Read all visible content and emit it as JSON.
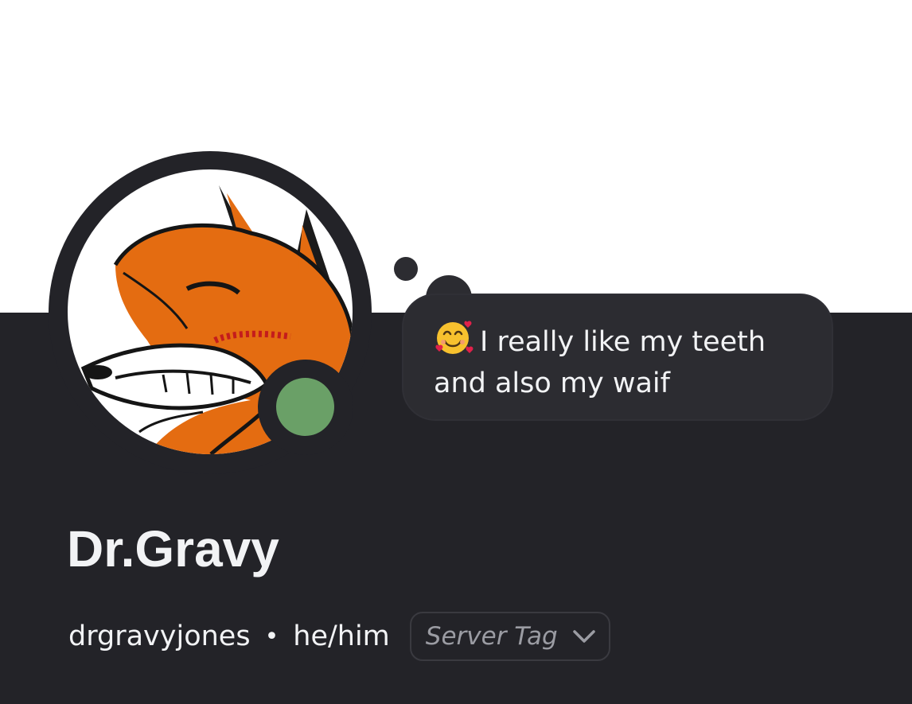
{
  "profile": {
    "display_name": "Dr.Gravy",
    "username": "drgravyjones",
    "separator": "•",
    "pronouns": "he/him",
    "status": "online",
    "status_color": "#6aa067"
  },
  "custom_status": {
    "emoji": "smiling-face-with-hearts",
    "line1": "I really like my teeth",
    "line2": "and also my waif"
  },
  "server_tag": {
    "label": "Server Tag",
    "icon": "chevron-down-icon"
  },
  "colors": {
    "banner": "#ffffff",
    "panel": "#232328",
    "bubble": "#2c2c31",
    "text": "#f2f3f5",
    "muted": "#9b9ca3"
  }
}
